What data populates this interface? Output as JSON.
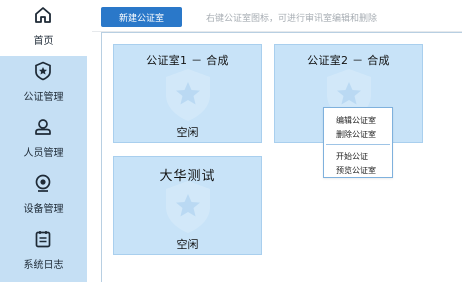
{
  "sidebar": {
    "items": [
      {
        "label": "首页",
        "icon": "home-icon",
        "active": true
      },
      {
        "label": "公证管理",
        "icon": "badge-star-icon",
        "active": false
      },
      {
        "label": "人员管理",
        "icon": "person-icon",
        "active": false
      },
      {
        "label": "设备管理",
        "icon": "camera-icon",
        "active": false
      },
      {
        "label": "系统日志",
        "icon": "log-icon",
        "active": false
      }
    ]
  },
  "toolbar": {
    "new_room_label": "新建公证室",
    "hint": "右键公证室图标，可进行审讯室编辑和删除"
  },
  "rooms": [
    {
      "title": "公证室1 － 合成",
      "status": "空闲"
    },
    {
      "title": "公证室2 － 合成",
      "status": ""
    },
    {
      "title": "大华测试",
      "status": "空闲"
    }
  ],
  "context_menu": {
    "items": [
      "编辑公证室",
      "删除公证室",
      "开始公证",
      "预览公证室"
    ]
  },
  "colors": {
    "sidebar_bg": "#c5dff4",
    "primary_button": "#2a78c9",
    "room_bg": "#c8e3f8",
    "menu_border": "#7fb1dd"
  }
}
